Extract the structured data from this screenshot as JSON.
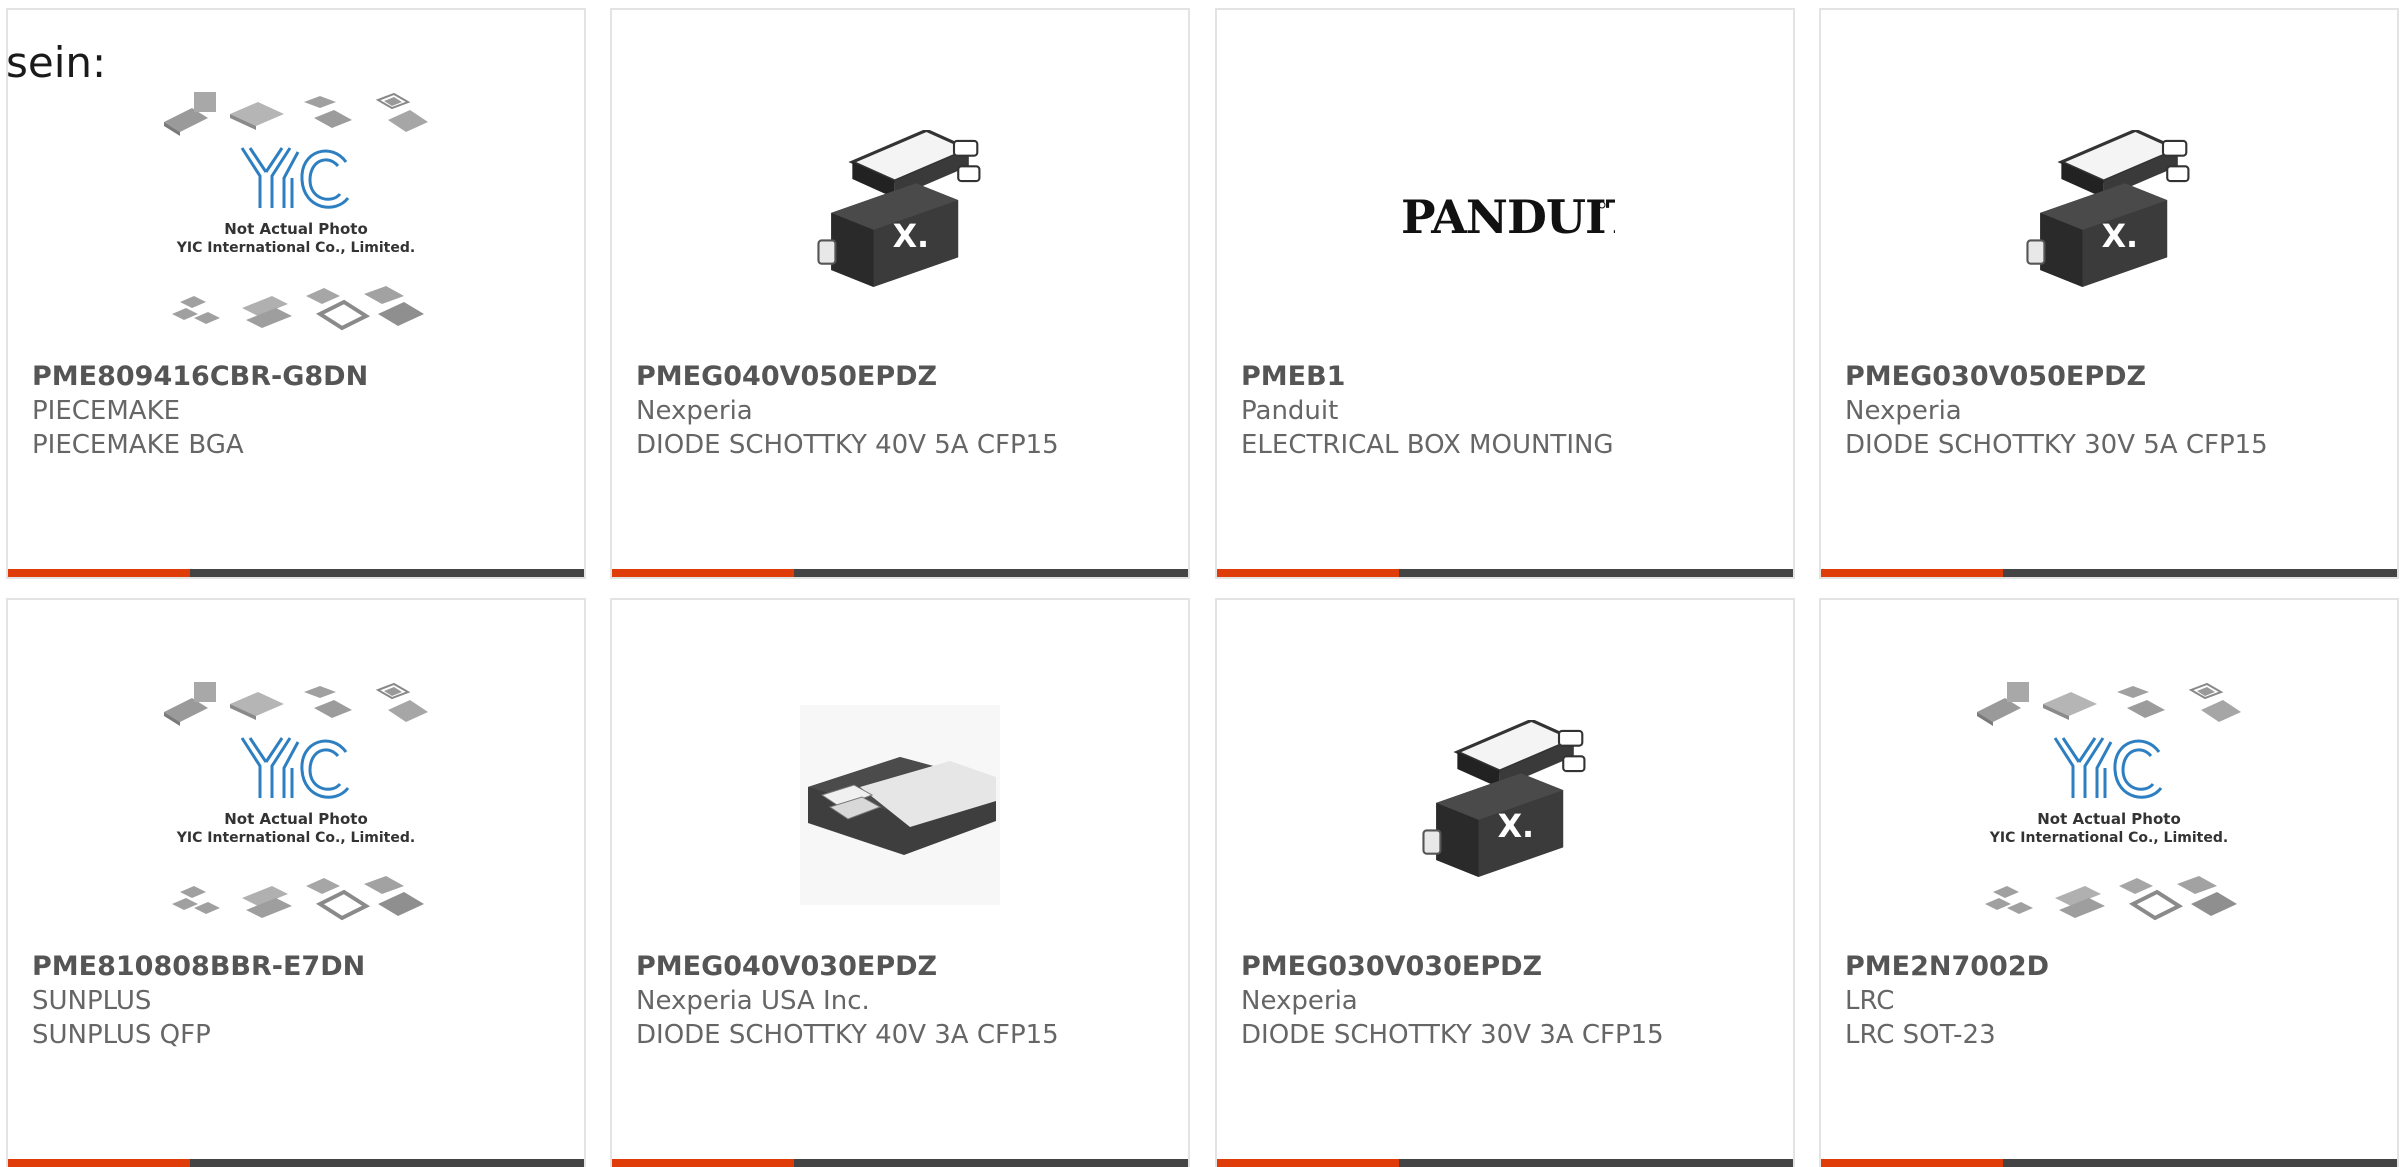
{
  "intro_text": "sein:",
  "colors": {
    "accent": "#e03c0a",
    "bar": "#444444",
    "border": "#e3e3e3",
    "yic_blue": "#2d7fc1"
  },
  "placeholder_image": {
    "line1": "Not Actual Photo",
    "line2": "YIC International Co., Limited."
  },
  "panduit_logo_text": "PANDUIT",
  "products": [
    {
      "part_number": "PME809416CBR-G8DN",
      "manufacturer": "PIECEMAKE",
      "description": "PIECEMAKE BGA",
      "image": "yic-placeholder-image"
    },
    {
      "part_number": "PMEG040V050EPDZ",
      "manufacturer": "Nexperia",
      "description": "DIODE SCHOTTKY 40V 5A CFP15",
      "image": "nexperia-diode-image"
    },
    {
      "part_number": "PMEB1",
      "manufacturer": "Panduit",
      "description": "ELECTRICAL BOX MOUNTING",
      "image": "panduit-logo-image"
    },
    {
      "part_number": "PMEG030V050EPDZ",
      "manufacturer": "Nexperia",
      "description": "DIODE SCHOTTKY 30V 5A CFP15",
      "image": "nexperia-diode-image"
    },
    {
      "part_number": "PME810808BBR-E7DN",
      "manufacturer": "SUNPLUS",
      "description": "SUNPLUS QFP",
      "image": "yic-placeholder-image"
    },
    {
      "part_number": "PMEG040V030EPDZ",
      "manufacturer": "Nexperia USA Inc.",
      "description": "DIODE SCHOTTKY 40V 3A CFP15",
      "image": "cfp15-package-image"
    },
    {
      "part_number": "PMEG030V030EPDZ",
      "manufacturer": "Nexperia",
      "description": "DIODE SCHOTTKY 30V 3A CFP15",
      "image": "nexperia-diode-image"
    },
    {
      "part_number": "PME2N7002D",
      "manufacturer": "LRC",
      "description": "LRC SOT-23",
      "image": "yic-placeholder-image"
    }
  ]
}
